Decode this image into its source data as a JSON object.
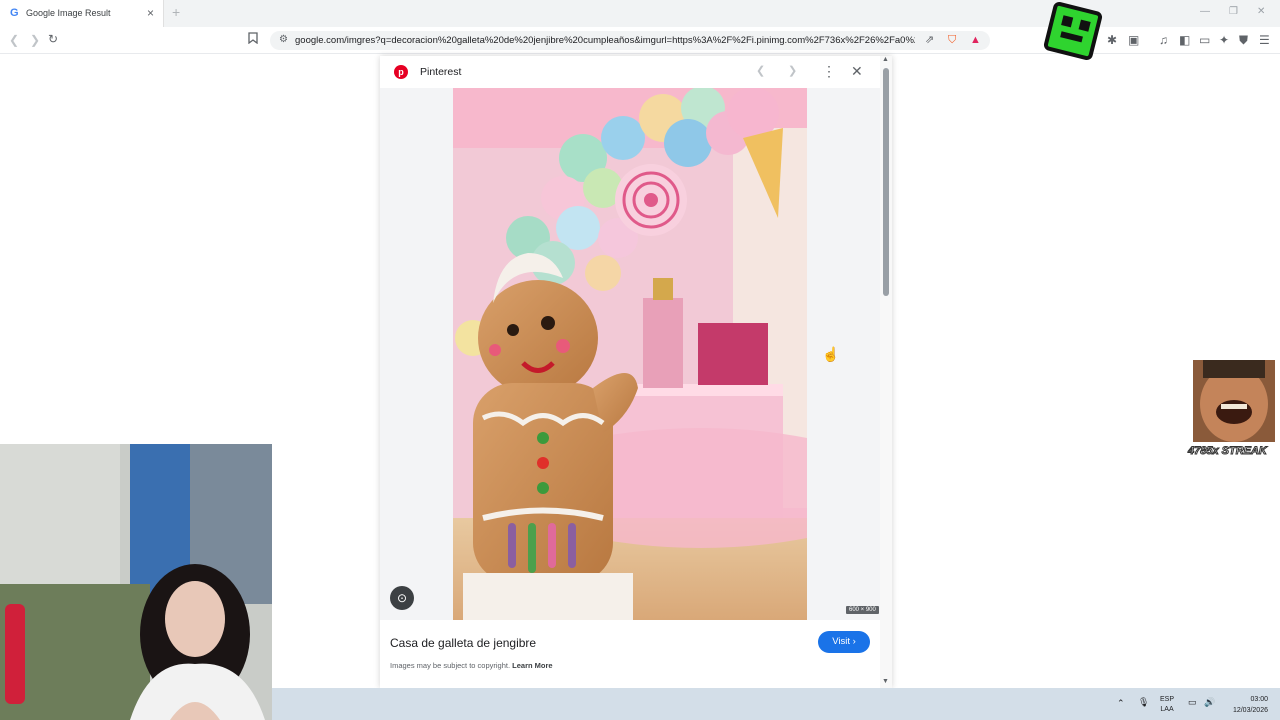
{
  "browser": {
    "tab_title": "Google Image Result",
    "tab_favicon": "G",
    "new_tab": "+",
    "url": "google.com/imgres?q=decoracion%20galleta%20de%20jenjibre%20cumpleaños&imgurl=https%3A%2F%2Fi.pinimg.com%2F736x%2F26%2Fa0%2F9...",
    "icons": [
      "back-icon",
      "forward-icon",
      "reload-icon",
      "bookmark-icon",
      "tune-icon",
      "share-icon",
      "brave-shield-icon",
      "brave-rewards-icon",
      "extensions-icon",
      "media-icon",
      "sidebar-icon",
      "wallet-icon",
      "leo-icon",
      "vpn-icon",
      "menu-icon"
    ],
    "accent": "#1a73e8"
  },
  "modal": {
    "source": "Pinterest",
    "image_title": "Casa de galleta de jengibre",
    "visit_label": "Visit",
    "copyright_text": "Images may be subject to copyright.",
    "learn_more": "Learn More",
    "dimensions": "600 × 900"
  },
  "overlay": {
    "streak_text": "4785x STREAK"
  },
  "taskbar": {
    "lang_line1": "ESP",
    "lang_line2": "LAA",
    "time": "03:00",
    "date": "12/03/2026"
  }
}
